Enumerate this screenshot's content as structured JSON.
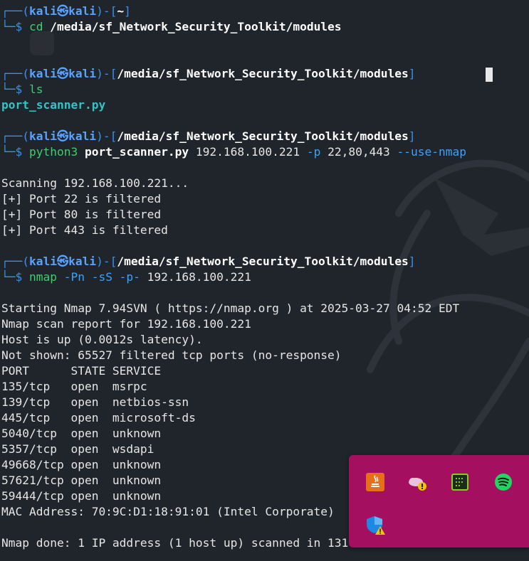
{
  "terminal": {
    "blocks": [
      {
        "prompt": {
          "top_left": "┌──(",
          "user": "kali",
          "at": "㉿",
          "host": "kali",
          "mid": ")-[",
          "path": "~",
          "end": "]"
        },
        "command": {
          "dollar": "└─$ ",
          "cmd": "cd",
          "rest": " /media/sf_Network_Security_Toolkit/modules"
        }
      }
    ],
    "prompt2": {
      "top_left": "┌──(",
      "user": "kali",
      "at": "㉿",
      "host": "kali",
      "mid": ")-[",
      "path": "/media/sf_Network_Security_Toolkit/modules",
      "end": "]"
    },
    "cmd2": {
      "dollar": "└─$ ",
      "cmd": "ls"
    },
    "ls_output": "port_scanner.py",
    "prompt3": {
      "top_left": "┌──(",
      "user": "kali",
      "at": "㉿",
      "host": "kali",
      "mid": ")-[",
      "path": "/media/sf_Network_Security_Toolkit/modules",
      "end": "]"
    },
    "cmd3": {
      "dollar": "└─$ ",
      "cmd": "python3",
      "file": "port_scanner.py",
      "ip": " 192.168.100.221",
      "opt1": " -p",
      "ports": " 22,80,443",
      "opt2": " --use-nmap"
    },
    "scan_output": [
      "Scanning 192.168.100.221...",
      "[+] Port 22 is filtered",
      "[+] Port 80 is filtered",
      "[+] Port 443 is filtered"
    ],
    "prompt4": {
      "top_left": "┌──(",
      "user": "kali",
      "at": "㉿",
      "host": "kali",
      "mid": ")-[",
      "path": "/media/sf_Network_Security_Toolkit/modules",
      "end": "]"
    },
    "cmd4": {
      "dollar": "└─$ ",
      "cmd": "nmap",
      "opts": " -Pn -sS -p-",
      "ip": " 192.168.100.221"
    },
    "nmap_output": [
      "Starting Nmap 7.94SVN ( https://nmap.org ) at 2025-03-27 04:52 EDT",
      "Nmap scan report for 192.168.100.221",
      "Host is up (0.0012s latency).",
      "Not shown: 65527 filtered tcp ports (no-response)",
      "PORT      STATE SERVICE",
      "135/tcp   open  msrpc",
      "139/tcp   open  netbios-ssn",
      "445/tcp   open  microsoft-ds",
      "5040/tcp  open  unknown",
      "5357/tcp  open  wsdapi",
      "49668/tcp open  unknown",
      "57621/tcp open  unknown",
      "59444/tcp open  unknown",
      "MAC Address: 70:9C:D1:18:91:01 (Intel Corporate)"
    ],
    "final_line": "Nmap done: 1 IP address (1 host up) scanned in 131"
  },
  "tray": {
    "icons": [
      "java-icon",
      "onedrive-warning-icon",
      "gpu-icon",
      "spotify-icon",
      "defender-warning-icon"
    ],
    "bg_color": "#a50f60"
  }
}
